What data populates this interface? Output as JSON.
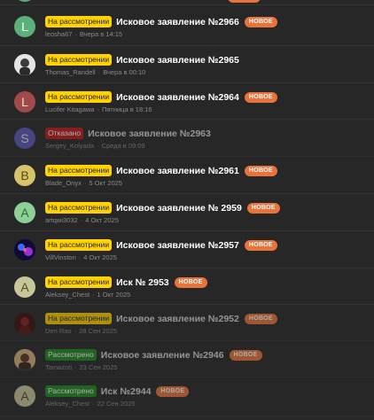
{
  "threads": [
    {
      "prefix": "На рассмотрении",
      "prefix_type": "review",
      "title": "Исковое заявление №2966",
      "new": "НОВОЕ",
      "author": "leosha67",
      "date": "Вчера в 14:15",
      "avatar": {
        "letter": "L",
        "bg": "#5cb07c",
        "fg": "#ffffff"
      },
      "dim": false
    },
    {
      "prefix": "На рассмотрении",
      "prefix_type": "review",
      "title": "Исковое заявление №2965",
      "new": "",
      "author": "Thomas_Randell",
      "date": "Вчера в 00:10",
      "avatar": {
        "letter": "",
        "image": "person-photo",
        "bg": "#d9d9d9"
      },
      "dim": false
    },
    {
      "prefix": "На рассмотрении",
      "prefix_type": "review",
      "title": "Исковое заявление №2964",
      "new": "НОВОЕ",
      "author": "Lucifer Kitagawa",
      "date": "Пятница в 18:16",
      "avatar": {
        "letter": "L",
        "bg": "#a24a4a",
        "fg": "#f3d6d6"
      },
      "dim": false
    },
    {
      "prefix": "Отказано",
      "prefix_type": "rejected",
      "title": "Исковое заявление №2963",
      "new": "",
      "author": "Sergey_Kolyada",
      "date": "Среда в 09:09",
      "avatar": {
        "letter": "S",
        "bg": "#5b5ab8",
        "fg": "#e6e6ff"
      },
      "dim": true
    },
    {
      "prefix": "На рассмотрении",
      "prefix_type": "review",
      "title": "Исковое заявление №2961",
      "new": "НОВОЕ",
      "author": "Blade_Onyx",
      "date": "5 Окт 2025",
      "avatar": {
        "letter": "B",
        "bg": "#d7c46a",
        "fg": "#5a4a10"
      },
      "dim": false
    },
    {
      "prefix": "На рассмотрении",
      "prefix_type": "review",
      "title": "Исковое заявление № 2959",
      "new": "НОВОЕ",
      "author": "artqwi3032",
      "date": "4 Окт 2025",
      "avatar": {
        "letter": "A",
        "bg": "#8fd09a",
        "fg": "#2c6b36"
      },
      "dim": false
    },
    {
      "prefix": "На рассмотрении",
      "prefix_type": "review",
      "title": "Исковое заявление №2957",
      "new": "НОВОЕ",
      "author": "VillVinston",
      "date": "4 Окт 2025",
      "avatar": {
        "letter": "",
        "image": "neon-photo",
        "bg": "#1a1240"
      },
      "dim": false
    },
    {
      "prefix": "На рассмотрении",
      "prefix_type": "review",
      "title": "Иск № 2953",
      "new": "НОВОЕ",
      "author": "Aleksey_Chest",
      "date": "1 Окт 2025",
      "avatar": {
        "letter": "A",
        "bg": "#c9c79a",
        "fg": "#4f4d2a"
      },
      "dim": false
    },
    {
      "prefix": "На рассмотрении",
      "prefix_type": "review",
      "title": "Исковое заявление №2952",
      "new": "НОВОЕ",
      "author": "Den Rao",
      "date": "28 Сен 2025",
      "avatar": {
        "letter": "",
        "image": "red-photo",
        "bg": "#4a1515"
      },
      "dim": true
    },
    {
      "prefix": "Рассмотрено",
      "prefix_type": "done",
      "title": "Исковое заявление №2946",
      "new": "НОВОЕ",
      "author": "Tamazoti",
      "date": "23 Сен 2025",
      "avatar": {
        "letter": "",
        "image": "person-photo-2",
        "bg": "#c9a06a"
      },
      "dim": true
    },
    {
      "prefix": "Рассмотрено",
      "prefix_type": "done",
      "title": "Иск №2944",
      "new": "НОВОЕ",
      "author": "Aleksey_Chest",
      "date": "22 Сен 2025",
      "avatar": {
        "letter": "A",
        "bg": "#c9c79a",
        "fg": "#4f4d2a"
      },
      "dim": true
    }
  ]
}
